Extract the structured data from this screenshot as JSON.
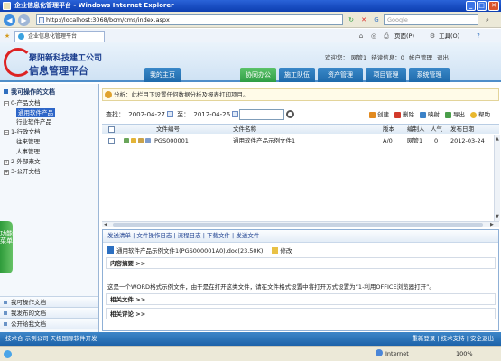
{
  "window": {
    "title": "企业信息化管理平台 - Windows Internet Explorer"
  },
  "browser": {
    "url": "http://localhost:3068/bcm/cms/index.aspx",
    "search_placeholder": "Google",
    "tab_title": "企业信息化管理平台",
    "commands": [
      "页面(P)",
      "工具(O)"
    ],
    "status_zone": "Internet",
    "zoom": "100%"
  },
  "app": {
    "logo_line1": "聚阳新科技建工公司",
    "logo_line2": "信息管理平台",
    "user_text": "欢迎您：",
    "user_name": "网管1",
    "messages": "待读信息：0",
    "account_link": "帐户管理",
    "logout_link": "退出",
    "nav": [
      "我的主页",
      "协同办公",
      "施工队伍",
      "资产管理",
      "项目管理",
      "系统管理"
    ],
    "active_nav": 1
  },
  "sidebar": {
    "title": "我可操作的文档",
    "tree": [
      {
        "label": "0-产品文档",
        "toggle": "−"
      },
      {
        "label": "通用软件产品",
        "selected": true
      },
      {
        "label": "行业软件产品"
      },
      {
        "label": "1-行政文档",
        "toggle": "−"
      },
      {
        "label": "往来管理"
      },
      {
        "label": "人事管理"
      },
      {
        "label": "2-外部来文",
        "toggle": "+"
      },
      {
        "label": "3-公开文档",
        "toggle": "+"
      }
    ],
    "func_menu": "功能菜单",
    "footer": [
      "我可操作文档",
      "我发布的文档",
      "公开给我文档"
    ]
  },
  "main": {
    "tip": "分析：此栏目下设置任何数据分析及报表打印项目。",
    "filter": {
      "label": "查找：",
      "from": "2002-04-27",
      "to_label": "至：",
      "to": "2012-04-26"
    },
    "toolbar": [
      "创建",
      "删除",
      "映射",
      "导出",
      "帮助"
    ],
    "columns": [
      "文件编号",
      "文件名称",
      "版本",
      "编制人",
      "人气",
      "发布日期"
    ],
    "rows": [
      {
        "code": "PGS000001",
        "name": "通用软件产品示例文件1",
        "version": "A/0",
        "author": "网管1",
        "views": "0",
        "date": "2012-03-24"
      }
    ]
  },
  "detail": {
    "tabs": [
      "发送清单",
      "文件操作日志",
      "流程日志",
      "下载文件",
      "发送文件"
    ],
    "attachment": "通用软件产品示例文件1(PGS000001A0).doc(23.50K)",
    "edit_label": "修改",
    "sections": [
      "内容摘要 >>",
      "相关文件 >>",
      "相关评论 >>"
    ],
    "description": "这是一个WORD格式示例文件，由于是在打开这类文件，请在文件格式设置中将打开方式设置为“1-利用OFFICE浏览器打开”。"
  },
  "footer": {
    "left": "技术合 示例公司 天极国际软件开发",
    "right": [
      "重新登录",
      "技术支持",
      "安全退出"
    ]
  },
  "colors": {
    "nav_blue": "#1e6aab",
    "nav_active": "#2f9d45",
    "header_line": "#4f8ec9"
  }
}
